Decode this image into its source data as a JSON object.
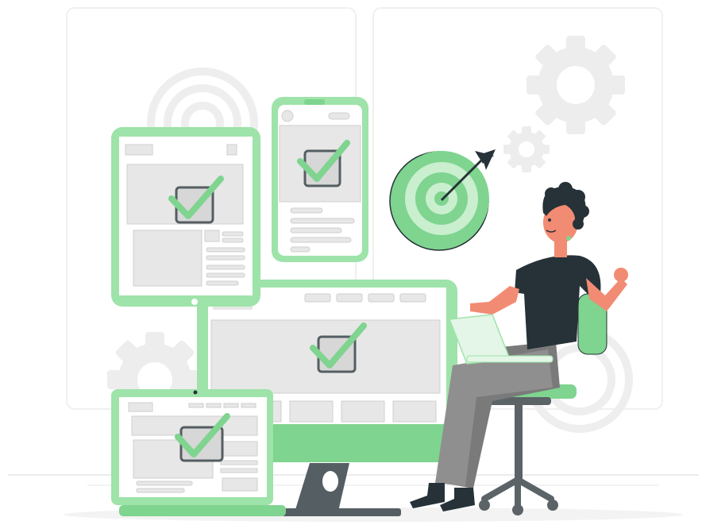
{
  "illustration": {
    "subject": "",
    "colors": {
      "accent": "#7fd48f",
      "accent_light": "#c9efcf",
      "accent_pale": "#e4f6e7",
      "outline": "#9ee3a9",
      "panel": "#e7e7e7",
      "panel_border": "#cfcfcf",
      "dark": "#263238",
      "skin": "#f28b73",
      "pants": "#8f8f8f",
      "gray_bg": "#f2f2f2"
    },
    "icons": [
      "gear-icon",
      "target-icon",
      "arrow-icon",
      "checkmark-icon",
      "chair-icon",
      "laptop-icon"
    ]
  }
}
